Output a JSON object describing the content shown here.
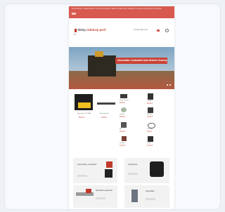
{
  "topbar": {
    "message": "Ostrzeżenie o ciasteczkach: Ta strona korzysta z plików cookies aby świadczyć usługi na najwyższym poziomie",
    "ok_label": "OK"
  },
  "header": {
    "logo_part1": "Sklep ",
    "logo_part2": "rolniczy",
    "logo_part3": " prof",
    "tagline": "ASK",
    "contact_link": "Kontakt Moje konto",
    "accent": "#d7594f"
  },
  "hero": {
    "banner_text": "Akumulator i Ładowarki Auto Srebrne Orzechy"
  },
  "products": [
    {
      "name": "Akumulator 12V 44Ah",
      "price": "89,00 zł"
    },
    {
      "name": "Nóż ogrodowy",
      "price": "29,99 zł"
    },
    {
      "name": "Pasek klinowy",
      "price": "49,00 zł"
    },
    {
      "name": "Czujnik",
      "price": "58,00 zł"
    },
    {
      "name": "Łożysko",
      "price": "39,00 zł"
    },
    {
      "name": "Złączka",
      "price": "12,00 zł"
    },
    {
      "name": "Filtr",
      "price": "25,00 zł"
    },
    {
      "name": "Pierścień",
      "price": "9,00 zł"
    },
    {
      "name": "Pompka",
      "price": "72,00 zł"
    },
    {
      "name": "Zawór",
      "price": "44,00 zł"
    }
  ],
  "promo": [
    {
      "title": "Akumulatory i ładowarki",
      "btn": "Zobacz"
    },
    {
      "title": "Oświetlenie",
      "btn": "Zobacz"
    },
    {
      "title": "Narzędzia ogrodowe",
      "btn": "Zobacz"
    },
    {
      "title": "Hydraulika",
      "btn": "Zobacz"
    }
  ]
}
